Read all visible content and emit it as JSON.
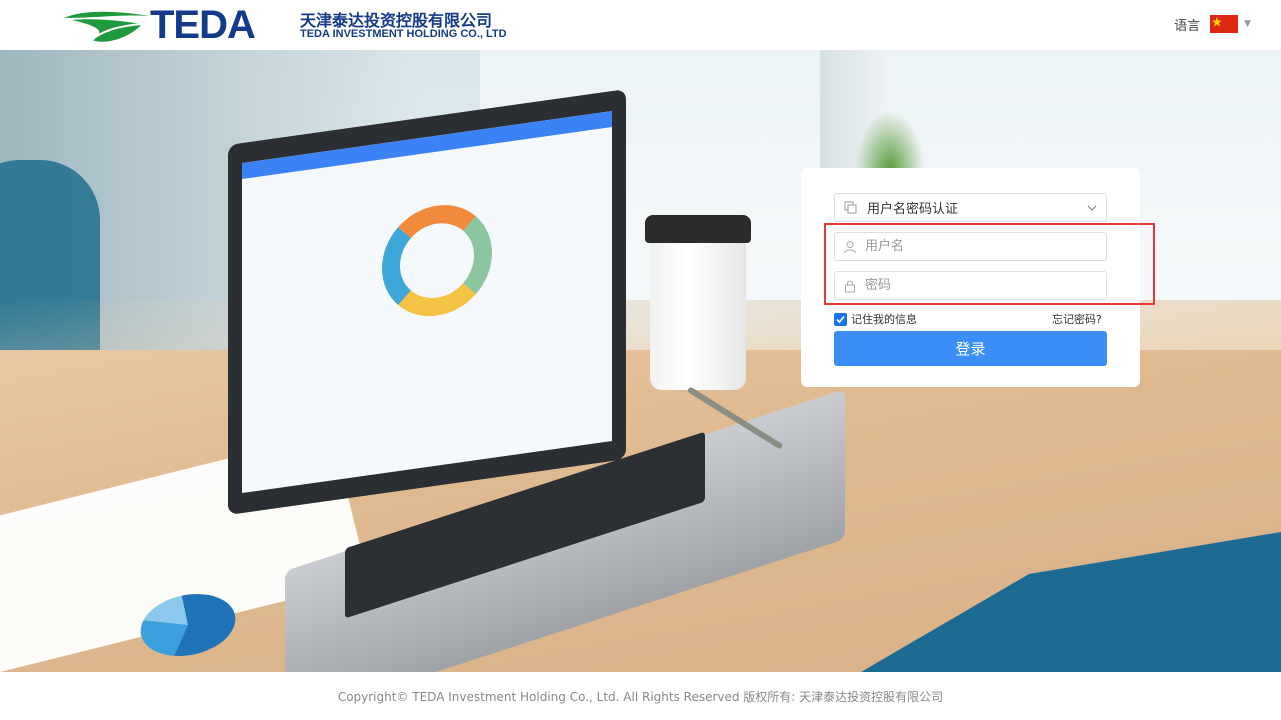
{
  "header": {
    "logo_word": "TEDA",
    "logo_cn": "天津泰达投资控股有限公司",
    "logo_en": "TEDA INVESTMENT HOLDING CO., LTD",
    "language_label": "语言",
    "flag_icon": "china-flag-icon"
  },
  "login": {
    "auth_method": "用户名密码认证",
    "username_placeholder": "用户名",
    "password_placeholder": "密码",
    "remember_label": "记住我的信息",
    "remember_checked": true,
    "forgot_label": "忘记密码?",
    "submit_label": "登录"
  },
  "footer": {
    "copyright": "Copyright© TEDA Investment Holding Co., Ltd. All Rights Reserved 版权所有: 天津泰达投资控股有限公司"
  },
  "colors": {
    "brand_blue": "#143a8a",
    "logo_green": "#1e9a3c",
    "button_blue": "#3a8ef6",
    "highlight_red": "#e53935"
  }
}
